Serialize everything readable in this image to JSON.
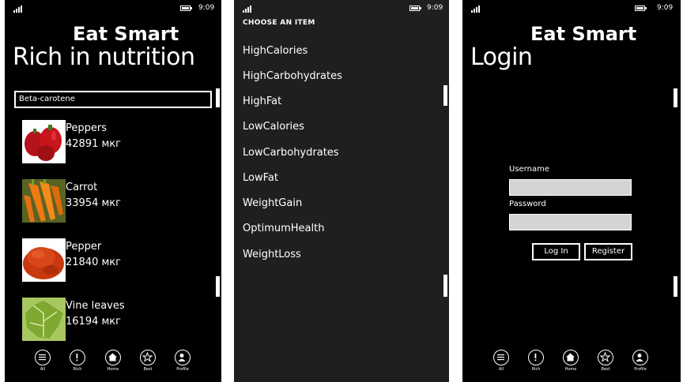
{
  "status": {
    "time": "9:09"
  },
  "screen1": {
    "app_title": "Eat Smart",
    "page_title": "Rich in nutrition",
    "search_value": "Beta-carotene",
    "foods": [
      {
        "name": "Peppers",
        "amount": "42891 мкг"
      },
      {
        "name": "Carrot",
        "amount": "33954 мкг"
      },
      {
        "name": "Pepper",
        "amount": "21840 мкг"
      },
      {
        "name": "Vine leaves",
        "amount": "16194 мкг"
      }
    ]
  },
  "screen2": {
    "header": "CHOOSE AN ITEM",
    "options": [
      "HighCalories",
      "HighCarbohydrates",
      "HighFat",
      "LowCalories",
      "LowCarbohydrates",
      "LowFat",
      "WeightGain",
      "OptimumHealth",
      "WeightLoss"
    ]
  },
  "screen3": {
    "app_title": "Eat Smart",
    "page_title": "Login",
    "username_label": "Username",
    "password_label": "Password",
    "username_value": "",
    "password_value": "",
    "login_label": "Log In",
    "register_label": "Register"
  },
  "appbar": {
    "buttons": [
      {
        "label": "All",
        "icon": "list-icon"
      },
      {
        "label": "Rich",
        "icon": "exclamation-icon"
      },
      {
        "label": "Home",
        "icon": "home-icon"
      },
      {
        "label": "Best",
        "icon": "star-icon"
      },
      {
        "label": "Profile",
        "icon": "profile-icon"
      }
    ]
  }
}
